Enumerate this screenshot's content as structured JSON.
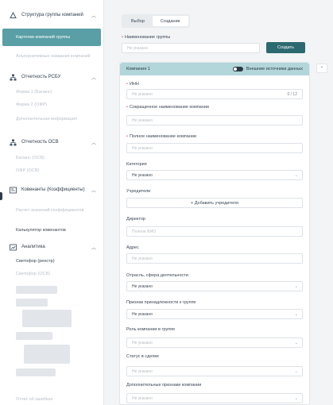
{
  "sidebar": {
    "sections": [
      {
        "label": "Структура группы компаний",
        "icon": "org-structure-icon"
      },
      {
        "label": "Отчетность РСБУ",
        "icon": "hierarchy-icon"
      },
      {
        "label": "Отчетность ОСВ",
        "icon": "hierarchy-icon"
      },
      {
        "label": "Ковенанты (Коэффициенты)",
        "icon": "covenants-icon"
      },
      {
        "label": "Аналитика",
        "icon": "analytics-icon"
      }
    ],
    "items": {
      "company_cards": "Карточки компаний группы",
      "alt_company_names": "Альтернативные названия компаний",
      "rsbu_form1": "Форма 1 (Баланс)",
      "rsbu_form2": "Форма 2 (ОФР)",
      "rsbu_extra": "Дополнительная информация",
      "osv_balance": "Баланс (ОСВ)",
      "osv_ofr": "ОФР (ОСВ)",
      "cov_calc": "Расчет значений коэффициентов",
      "cov_calculator": "Калькулятор ковенантов",
      "traffic_registry": "Светофор (реестр)",
      "traffic_osv": "Светофор (ОСВ)",
      "error_report": "Отчет об ошибках"
    }
  },
  "tabs": [
    "Выбор",
    "Создание"
  ],
  "group": {
    "label": "Наименование группы",
    "placeholder": "Не указано",
    "create_button": "Создать"
  },
  "card": {
    "title": "Компания 1",
    "toggle_label": "Внешние источники данных",
    "fields": {
      "inn": {
        "label": "ИНН",
        "placeholder": "Не указано",
        "counter": "0 / 12"
      },
      "short_name": {
        "label": "Сокращенное наименование компании",
        "placeholder": "Не указано"
      },
      "full_name": {
        "label": "Полное наименование компании",
        "placeholder": "Не указано"
      },
      "category": {
        "label": "Категория",
        "value": "Не указано"
      },
      "founders": {
        "label": "Учредители",
        "add_button": "+ Добавить учредителя"
      },
      "director": {
        "label": "Директор",
        "placeholder": "Полное ФИО"
      },
      "address": {
        "label": "Адрес",
        "placeholder": "Не указано"
      },
      "industry": {
        "label": "Отрасль, сфера деятельности",
        "value": "Не указано"
      },
      "membership": {
        "label": "Признак принадлежности к группе",
        "value": "Не указано"
      },
      "role": {
        "label": "Роль компании в группе",
        "value": "Не указано"
      },
      "deal_status": {
        "label": "Статус в сделке",
        "value": "Не указано"
      },
      "extra_attrs": {
        "label": "Дополнительные признаки компании",
        "value": "Не указано"
      }
    }
  }
}
